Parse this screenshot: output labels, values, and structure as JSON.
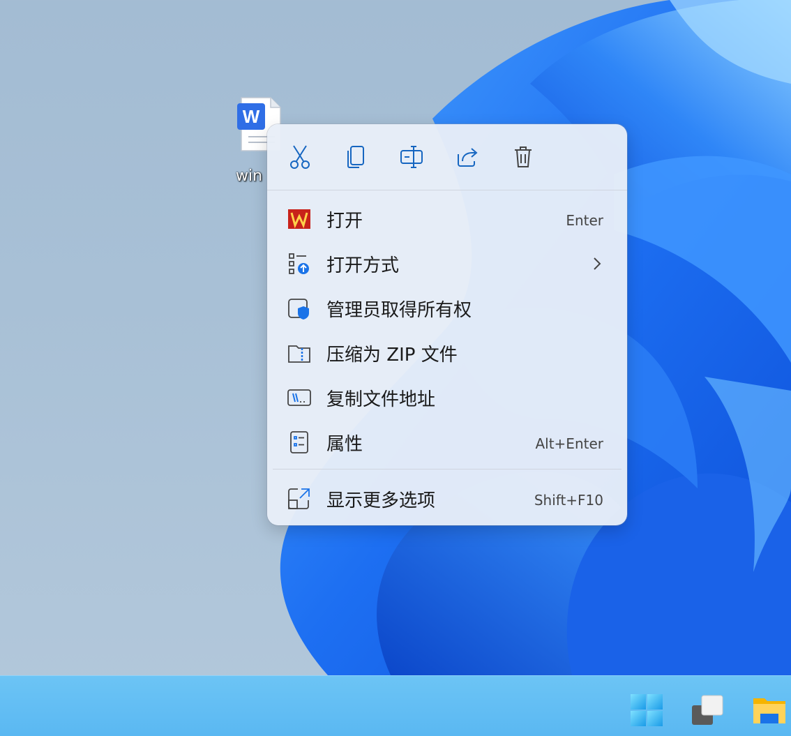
{
  "desktop": {
    "file": {
      "name": "win"
    }
  },
  "context_menu": {
    "toolbar": [
      {
        "icon": "cut-icon"
      },
      {
        "icon": "copy-icon"
      },
      {
        "icon": "rename-icon"
      },
      {
        "icon": "share-icon"
      },
      {
        "icon": "delete-icon"
      }
    ],
    "items": [
      {
        "label": "打开",
        "shortcut": "Enter",
        "icon": "wps-icon"
      },
      {
        "label": "打开方式",
        "shortcut": "",
        "icon": "open-with-icon",
        "submenu": true
      },
      {
        "label": "管理员取得所有权",
        "shortcut": "",
        "icon": "shield-icon"
      },
      {
        "label": "压缩为 ZIP 文件",
        "shortcut": "",
        "icon": "zip-folder-icon"
      },
      {
        "label": "复制文件地址",
        "shortcut": "",
        "icon": "copy-path-icon"
      },
      {
        "label": "属性",
        "shortcut": "Alt+Enter",
        "icon": "properties-icon"
      },
      {
        "label": "显示更多选项",
        "shortcut": "Shift+F10",
        "icon": "more-options-icon"
      }
    ]
  },
  "taskbar": {
    "icons": [
      "start-icon",
      "task-view-icon",
      "file-explorer-icon"
    ]
  },
  "colors": {
    "accent": "#0a6fd6",
    "wallpaper_blue": "#1f6ef0",
    "taskbar": "#5ab8f2"
  }
}
